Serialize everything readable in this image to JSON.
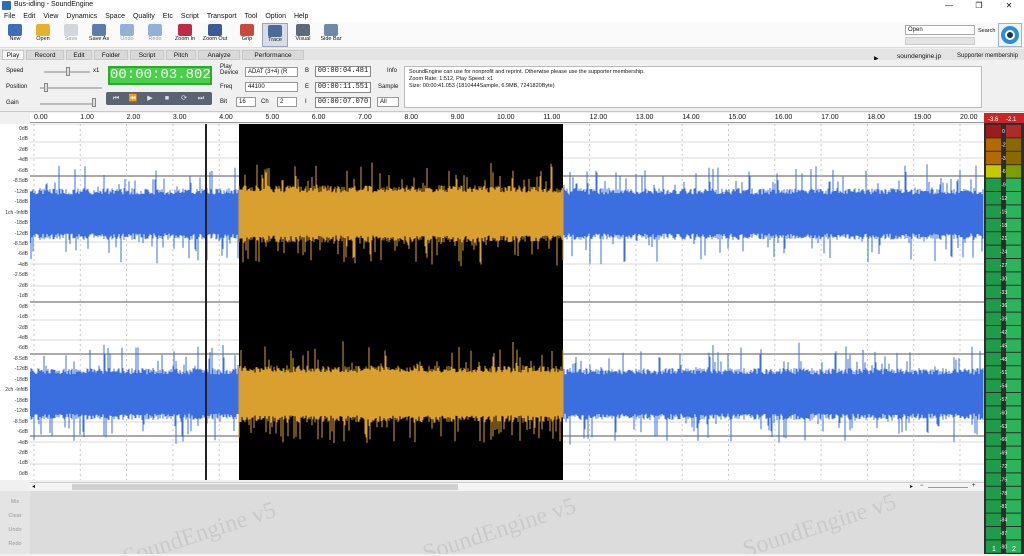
{
  "window": {
    "title": "Bus-idling - SoundEngine"
  },
  "menu": [
    "File",
    "Edit",
    "View",
    "Dynamics",
    "Space",
    "Quality",
    "Etc",
    "Script",
    "Transport",
    "Tool",
    "Option",
    "Help"
  ],
  "toolbar": {
    "buttons": [
      {
        "label": "New",
        "icon": "new-icon",
        "color": "#3d6fb6",
        "enabled": true
      },
      {
        "label": "Open",
        "icon": "open-folder-icon",
        "color": "#e6b12f",
        "enabled": true
      },
      {
        "label": "Save",
        "icon": "save-icon",
        "color": "#aab4c0",
        "enabled": false
      },
      {
        "label": "Save As",
        "icon": "save-as-icon",
        "color": "#5a7dab",
        "enabled": true
      },
      {
        "label": "Undo",
        "icon": "undo-icon",
        "color": "#2a67b8",
        "enabled": false
      },
      {
        "label": "Redo",
        "icon": "redo-icon",
        "color": "#2a67b8",
        "enabled": false
      },
      {
        "label": "Zoom In",
        "icon": "zoom-in-icon",
        "color": "#c02a45",
        "enabled": true
      },
      {
        "label": "Zoom Out",
        "icon": "zoom-out-icon",
        "color": "#3a5a9a",
        "enabled": true
      },
      {
        "label": "Grip",
        "icon": "grip-icon",
        "color": "#c94a3a",
        "enabled": true
      },
      {
        "label": "Trace",
        "icon": "trace-icon",
        "color": "#4a6a9a",
        "enabled": true
      },
      {
        "label": "Visual",
        "icon": "visual-eye-icon",
        "color": "#5b6b7c",
        "enabled": true
      },
      {
        "label": "Side Bar",
        "icon": "side-bar-icon",
        "color": "#6e8aaa",
        "enabled": true
      }
    ],
    "search_value": "Open",
    "search_label": "Search"
  },
  "tabs": [
    "Play",
    "Record",
    "Edit",
    "Folder",
    "Script",
    "Pitch",
    "Analyze",
    "Performance"
  ],
  "links": {
    "site": "soundengine.jp",
    "membership": "Supporter membership"
  },
  "controls": {
    "speed_label": "Speed",
    "speed_value": "x1",
    "position_label": "Position",
    "gain_label": "Gain",
    "timer": "00:00:03.802",
    "play_device_label": "Play Device",
    "play_device_value": "ADAT (3+4) (R",
    "freq_label": "Freq",
    "freq_value": "44100",
    "bit_label": "Bit",
    "bit_value": "16",
    "ch_label": "Ch",
    "ch_value": "2",
    "b_label": "B",
    "b_value": "00:00:04.481",
    "e_label": "E",
    "e_value": "00:00:11.551",
    "i_label": "I",
    "i_value": "00:00:07.070",
    "info_label": "Info",
    "sample_label": "Sample",
    "all_value": "All"
  },
  "transport": [
    "⏮",
    "⏪",
    "▶",
    "■",
    "⟳",
    "⏭"
  ],
  "info_text": [
    "SoundEngine can use for nonprofit and reprint. Otherwise please use the supporter membership.",
    "Zoom Rate: 1:512, Play Speed: x1",
    "Size: 00:00:41.053 (1810444Sample, 6.9MB, 7241820Byte)"
  ],
  "ruler": [
    "0.00",
    "1.00",
    "2.00",
    "3.00",
    "4.00",
    "5.00",
    "6.00",
    "7.00",
    "8.00",
    "9.00",
    "10.00",
    "11.00",
    "12.00",
    "13.00",
    "14.00",
    "15.00",
    "16.00",
    "17.00",
    "18.00",
    "19.00",
    "20.00"
  ],
  "db_labels": [
    "0dB",
    "-1dB",
    "-2dB",
    "-4dB",
    "-6dB",
    "-8.5dB",
    "-12dB",
    "-18dB",
    "1ch -InfdB",
    "-18dB",
    "-12dB",
    "-8.5dB",
    "-6dB",
    "-4dB",
    "-2.5dB",
    "-2dB",
    "-1dB",
    "0dB",
    "-1dB",
    "-2dB",
    "-4dB",
    "-6dB",
    "-8.5dB",
    "-12dB",
    "-18dB",
    "2ch -InfdB",
    "-18dB",
    "-12dB",
    "-8.5dB",
    "-6dB",
    "-4dB",
    "-2dB",
    "-1dB",
    "0dB"
  ],
  "meter": {
    "top_left": "-3.6",
    "top_right": "-2.1",
    "scale": [
      "0",
      "-2",
      "-3",
      "-6",
      "-9",
      "-12",
      "-15",
      "-18",
      "-21",
      "-24",
      "-27",
      "-30",
      "-33",
      "-36",
      "-39",
      "-42",
      "-45",
      "-48",
      "-51",
      "-54",
      "-57",
      "-60",
      "-63",
      "-66",
      "-69",
      "-72",
      "-75",
      "-78",
      "-81",
      "-84",
      "-87",
      "-90"
    ],
    "bottom_left": "1",
    "bottom_right": "2"
  },
  "side_buttons": [
    "Mix",
    "Clear",
    "Undo",
    "Redo"
  ],
  "colors": {
    "waveform": "#3b6fe0",
    "selection_bg": "#000000",
    "selection_wave": "#d9a030",
    "timer_bg": "#49d049"
  }
}
